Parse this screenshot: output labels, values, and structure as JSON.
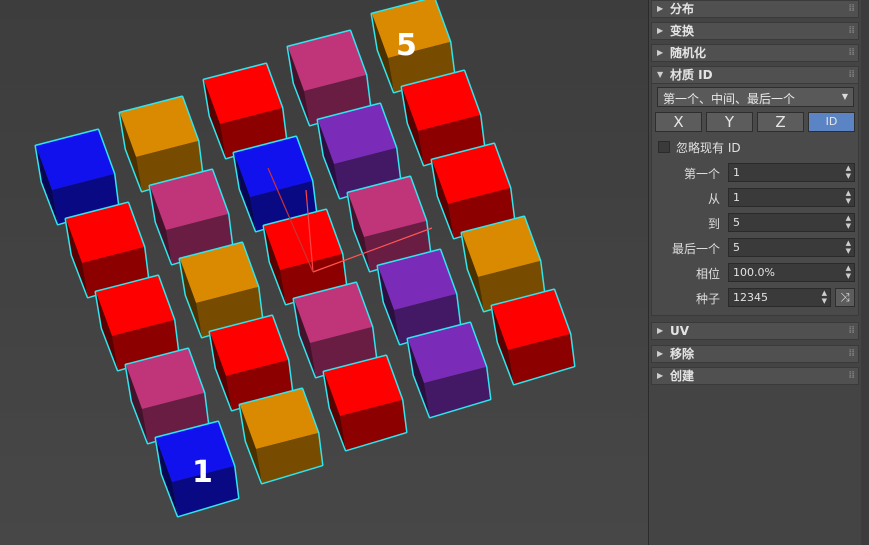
{
  "viewport": {
    "label_start": "1",
    "label_end": "5",
    "colors": {
      "red": "#ff0000",
      "blue": "#1111ee",
      "orange": "#d98a00",
      "pink": "#c0357a",
      "purple": "#7a2bb8",
      "outline": "#2ee6ee"
    },
    "columns": [
      [
        "blue",
        "red",
        "red",
        "pink",
        "blue"
      ],
      [
        "orange",
        "pink",
        "orange",
        "red",
        "orange"
      ],
      [
        "red",
        "blue",
        "red",
        "pink",
        "red"
      ],
      [
        "pink",
        "purple",
        "pink",
        "purple",
        "purple"
      ],
      [
        "orange",
        "red",
        "red",
        "orange",
        "red"
      ]
    ]
  },
  "panel": {
    "rollouts": {
      "distribution": "分布",
      "transform": "变换",
      "randomize": "随机化",
      "material_id": "材质 ID",
      "uv": "UV",
      "remove": "移除",
      "create": "创建"
    },
    "material": {
      "mode": "第一个、中间、最后一个",
      "axis_x": "X",
      "axis_y": "Y",
      "axis_z": "Z",
      "axis_id": "ID",
      "ignore_existing": "忽略现有 ID",
      "rows": {
        "first_label": "第一个",
        "first_value": "1",
        "from_label": "从",
        "from_value": "1",
        "to_label": "到",
        "to_value": "5",
        "last_label": "最后一个",
        "last_value": "5",
        "phase_label": "相位",
        "phase_value": "100.0%",
        "seed_label": "种子",
        "seed_value": "12345"
      }
    }
  }
}
